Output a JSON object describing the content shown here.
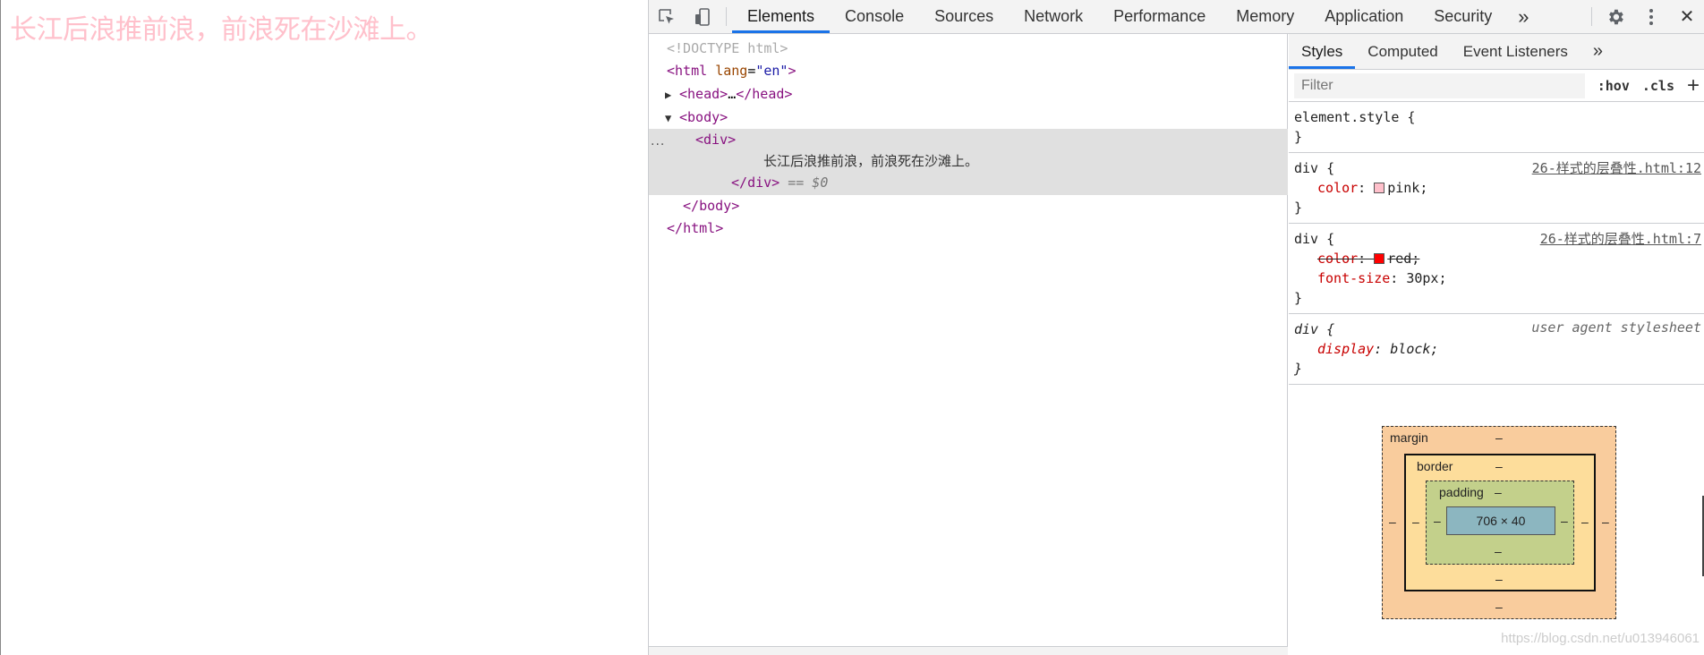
{
  "page": {
    "div_text": "长江后浪推前浪，前浪死在沙滩上。"
  },
  "toolbar": {
    "tabs": [
      "Elements",
      "Console",
      "Sources",
      "Network",
      "Performance",
      "Memory",
      "Application",
      "Security"
    ],
    "more": "»",
    "settings_icon": "gear-icon",
    "menu_icon": "kebab-icon",
    "close": "✕"
  },
  "dom": {
    "doctype": "<!DOCTYPE html>",
    "html_open_tag": "html",
    "html_attr_name": "lang",
    "html_attr_value": "\"en\"",
    "head_tag": "head",
    "head_ellipsis": "…",
    "body_tag": "body",
    "div_tag": "div",
    "div_text": "长江后浪推前浪，前浪死在沙滩上。",
    "selected_marker": "== $0",
    "dots": "···"
  },
  "sidebar": {
    "tabs": [
      "Styles",
      "Computed",
      "Event Listeners"
    ],
    "more": "»",
    "filter_placeholder": "Filter",
    "hov": ":hov",
    "cls": ".cls",
    "plus": "+",
    "rules": {
      "element_style": {
        "selector": "element.style {",
        "close": "}"
      },
      "rule1": {
        "selector": "div {",
        "source": "26-样式的层叠性.html:12",
        "prop": "color",
        "value": "pink;",
        "swatch": "#ffc0cb",
        "close": "}"
      },
      "rule2": {
        "selector": "div {",
        "source": "26-样式的层叠性.html:7",
        "prop1": "color",
        "value1": "red;",
        "swatch": "#ff0000",
        "prop2": "font-size",
        "value2": "30px;",
        "close": "}"
      },
      "rule3": {
        "selector": "div {",
        "source": "user agent stylesheet",
        "prop": "display",
        "value": "block;",
        "close": "}"
      }
    },
    "box_model": {
      "margin_label": "margin",
      "border_label": "border",
      "padding_label": "padding",
      "dash": "–",
      "content_size": "706 × 40"
    },
    "watermark": "https://blog.csdn.net/u013946061"
  },
  "colors": {
    "accent": "#1a73e8",
    "page_text": "#ffc0cb",
    "tag": "#881280"
  }
}
